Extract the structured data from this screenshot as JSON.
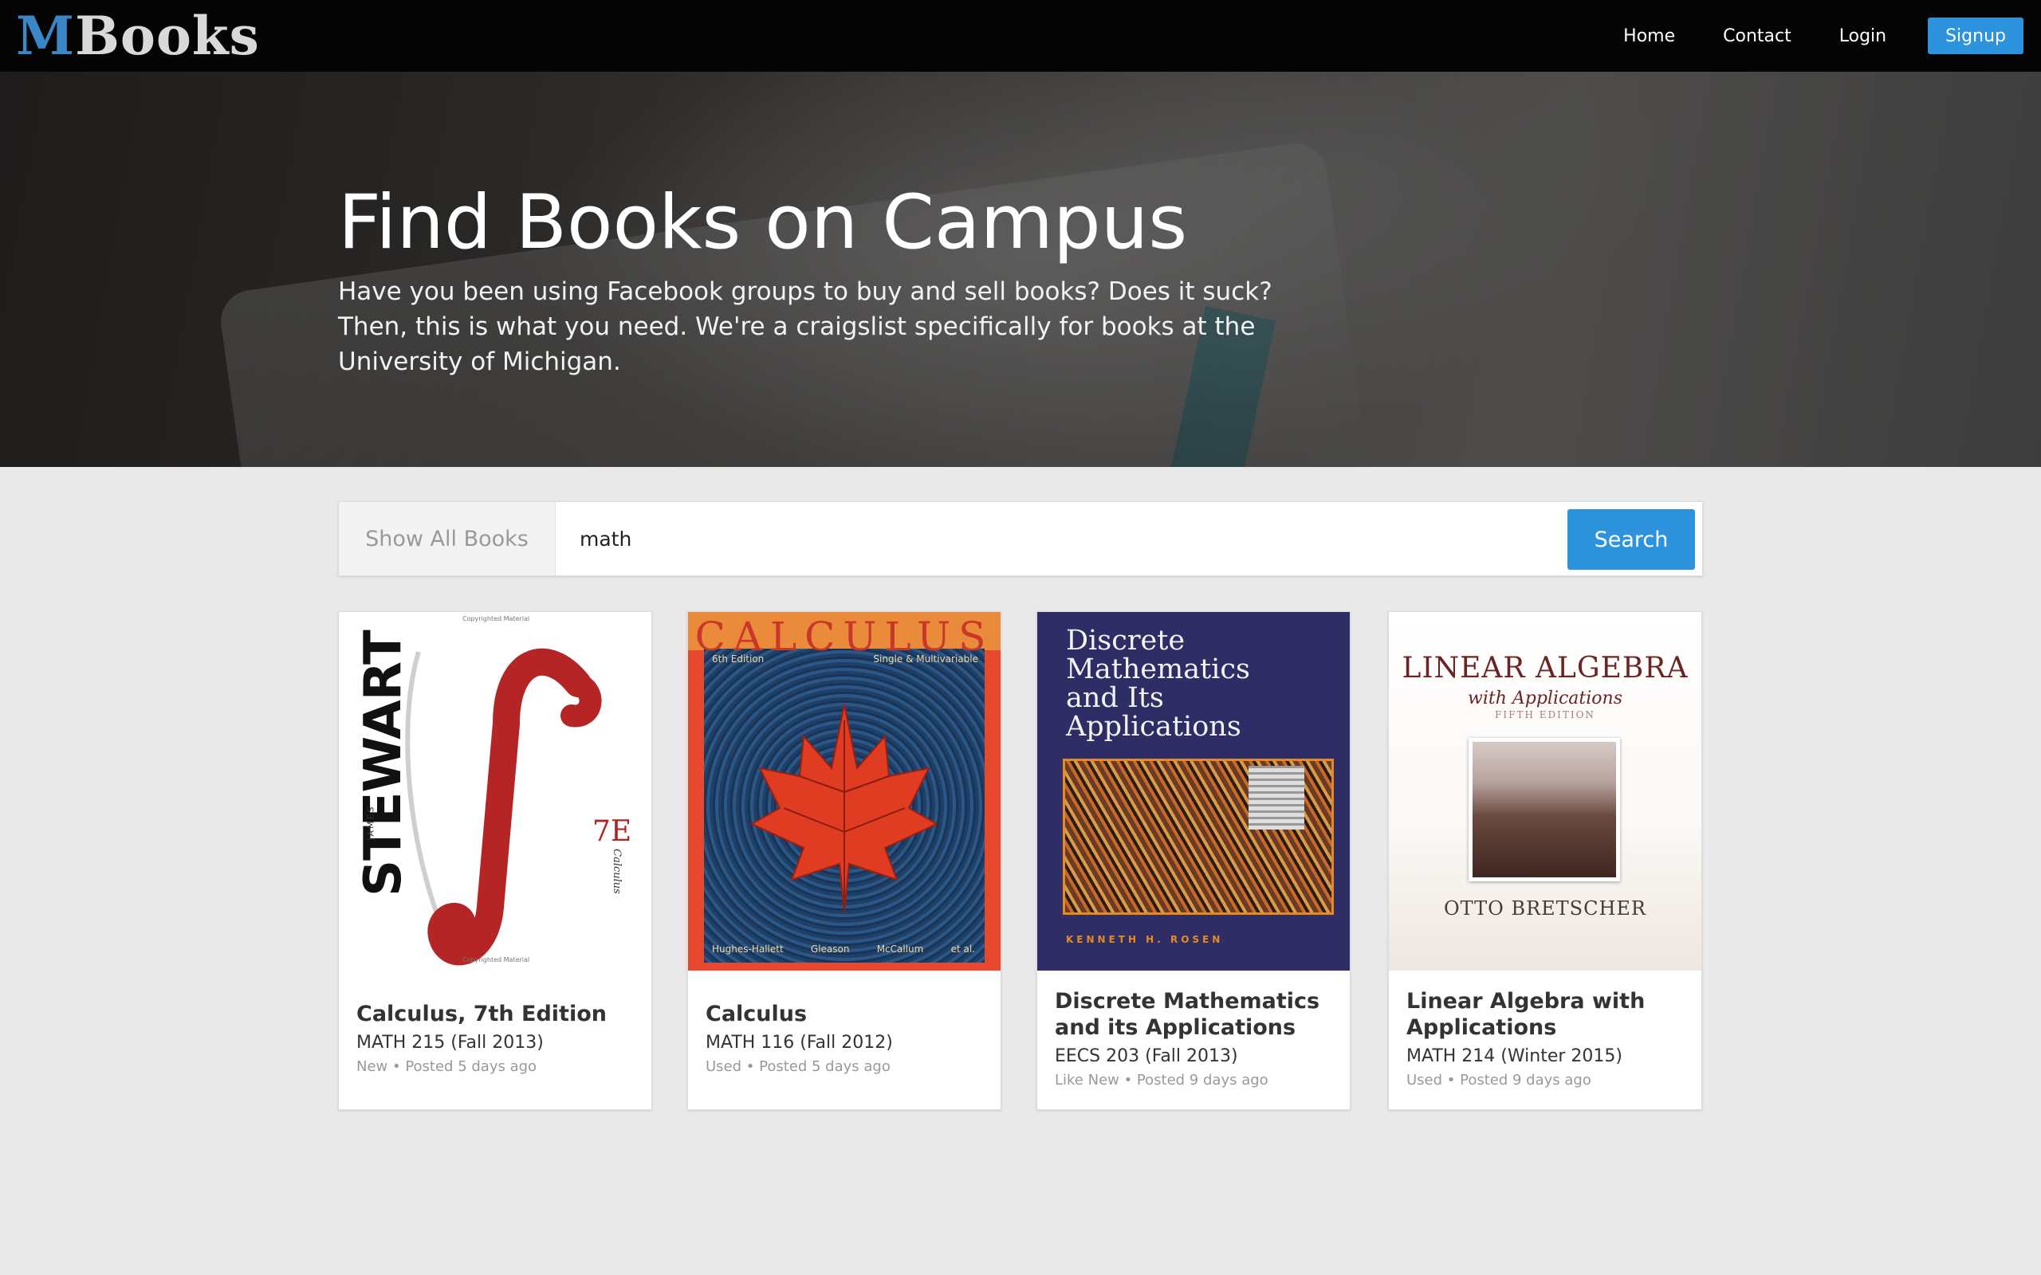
{
  "navbar": {
    "logo_m": "M",
    "logo_rest": "Books",
    "links": [
      "Home",
      "Contact",
      "Login"
    ],
    "signup": "Signup"
  },
  "hero": {
    "title": "Find Books on Campus",
    "subtitle": "Have you been using Facebook groups to buy and sell books? Does it suck? Then, this is what you need. We're a craigslist specifically for books at the University of Michigan."
  },
  "search": {
    "show_all": "Show All Books",
    "value": "math",
    "button": "Search"
  },
  "books": [
    {
      "title": "Calculus, 7th Edition",
      "course": "MATH 215 (Fall 2013)",
      "meta": "New • Posted 5 days ago",
      "cover": {
        "author": "STEWART",
        "author_first": "JAMES",
        "edition": "7E",
        "subtitle": "Calculus",
        "copyright": "Copyrighted Material"
      }
    },
    {
      "title": "Calculus",
      "course": "MATH 116 (Fall 2012)",
      "meta": "Used • Posted 5 days ago",
      "cover": {
        "title": "CALCULUS",
        "edition": "6th Edition",
        "variant": "Single & Multivariable",
        "authors": [
          "Hughes-Hallett",
          "Gleason",
          "McCallum",
          "et al."
        ]
      }
    },
    {
      "title": "Discrete Mathematics and its Applications",
      "course": "EECS 203 (Fall 2013)",
      "meta": "Like New • Posted 9 days ago",
      "cover": {
        "title_lines": [
          "Discrete",
          "Mathematics",
          "and Its",
          "Applications"
        ],
        "author": "KENNETH H. ROSEN"
      }
    },
    {
      "title": "Linear Algebra with Applications",
      "course": "MATH 214 (Winter 2015)",
      "meta": "Used • Posted 9 days ago",
      "cover": {
        "title": "LINEAR ALGEBRA",
        "with": "with Applications",
        "edition": "FIFTH EDITION",
        "author": "OTTO BRETSCHER"
      }
    }
  ],
  "colors": {
    "accent": "#2e93dd",
    "navbar_bg": "#050505",
    "page_bg": "#e9e9e9"
  }
}
